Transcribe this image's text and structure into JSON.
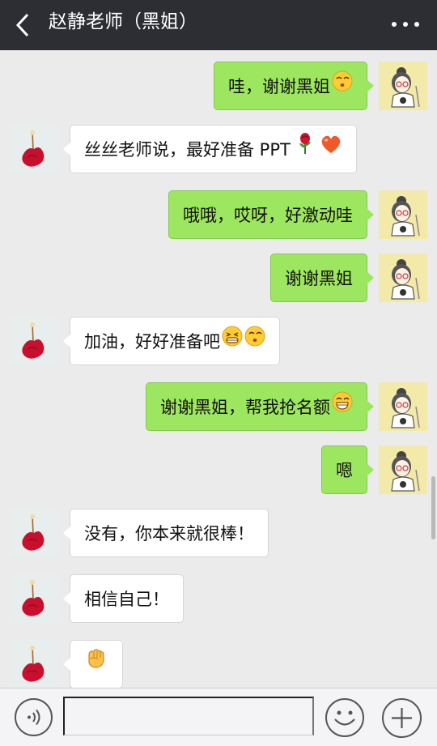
{
  "header": {
    "title": "赵静老师（黑姐）"
  },
  "messages": [
    {
      "from": "me",
      "text": "哇，谢谢黑姐",
      "emojis": [
        "kiss"
      ]
    },
    {
      "from": "other",
      "text": "丝丝老师说，最好准备 PPT",
      "emojis": [
        "rose",
        "heart"
      ]
    },
    {
      "from": "me",
      "text": "哦哦，哎呀，好激动哇",
      "emojis": []
    },
    {
      "from": "me",
      "text": "谢谢黑姐",
      "emojis": []
    },
    {
      "from": "other",
      "text": "加油，好好准备吧",
      "emojis": [
        "grimace",
        "kiss"
      ]
    },
    {
      "from": "me",
      "text": "谢谢黑姐，帮我抢名额",
      "emojis": [
        "grin"
      ]
    },
    {
      "from": "me",
      "text": "嗯",
      "emojis": []
    },
    {
      "from": "other",
      "text": "没有，你本来就很棒！",
      "emojis": []
    },
    {
      "from": "other",
      "text": "相信自己！",
      "emojis": []
    },
    {
      "from": "other",
      "text": "",
      "emojis": [
        "fist"
      ]
    }
  ],
  "input": {
    "value": ""
  },
  "colors": {
    "header_bg": "#2d2e33",
    "chat_bg": "#ebebeb",
    "my_bubble": "#9de65f",
    "their_bubble": "#ffffff"
  },
  "icons": {
    "back": "chevron-left-icon",
    "more": "more-dots-icon",
    "voice": "voice-icon",
    "emoji": "emoji-face-icon",
    "plus": "plus-icon"
  }
}
